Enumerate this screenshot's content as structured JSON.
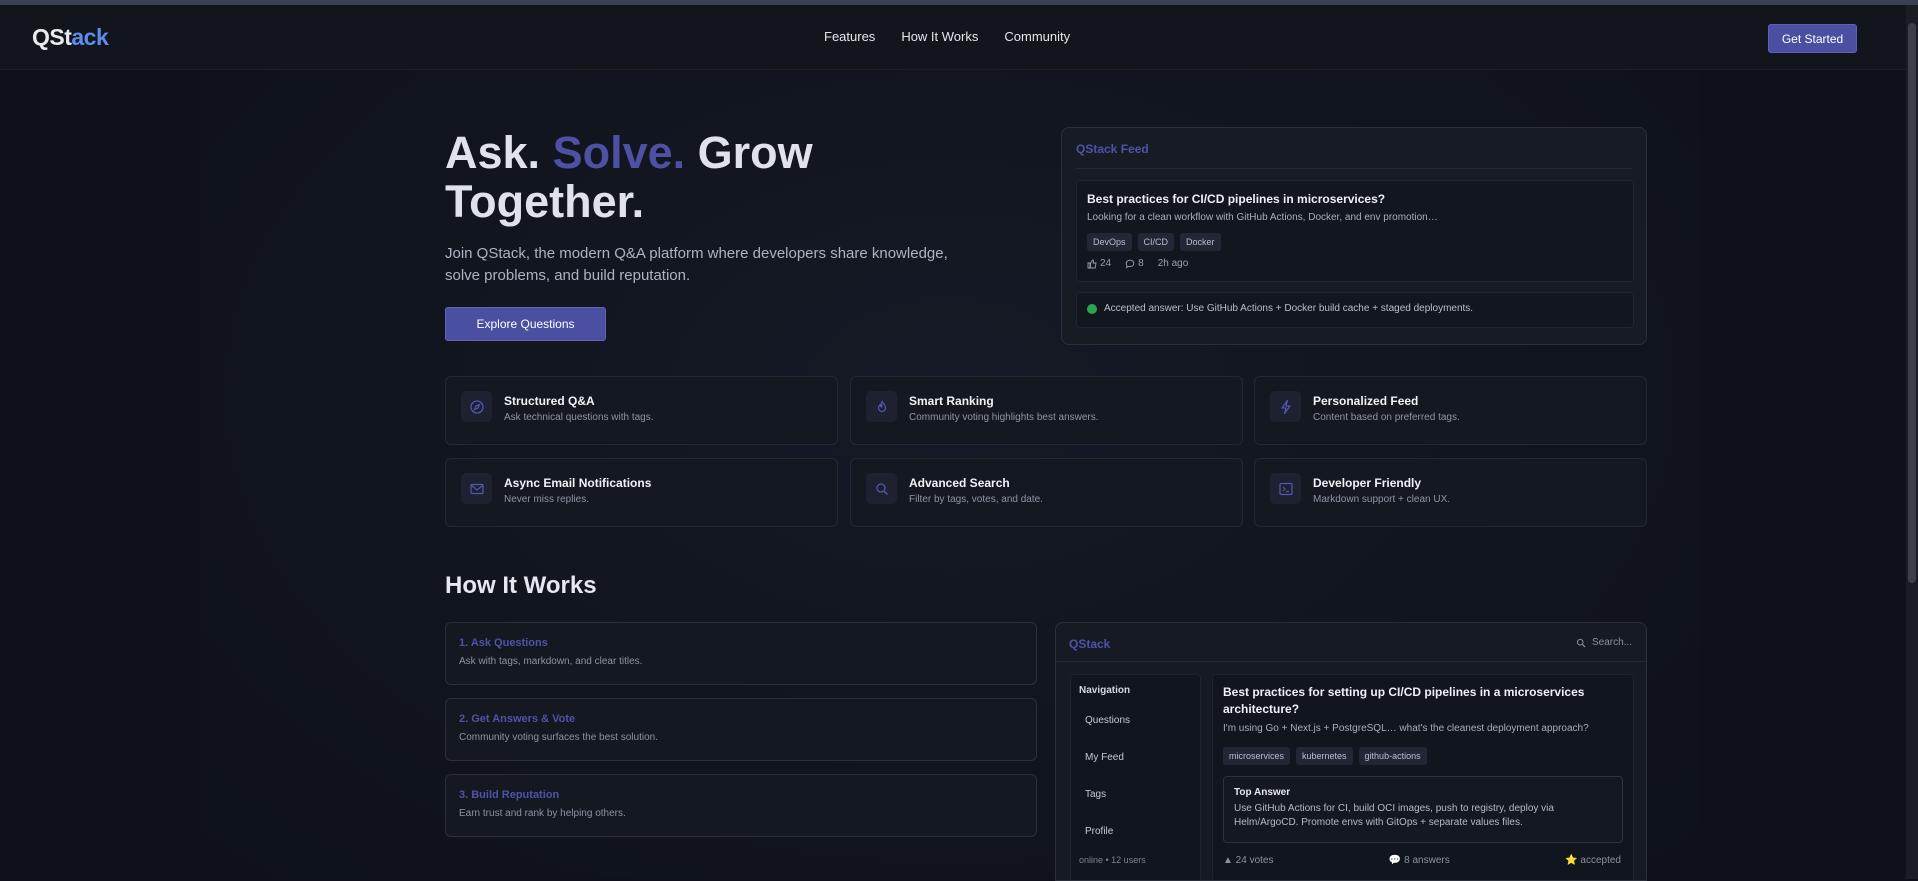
{
  "nav": {
    "logo_part1": "QSt",
    "logo_part2": "ack",
    "links": [
      "Features",
      "How It Works",
      "Community"
    ],
    "cta": "Get Started"
  },
  "hero": {
    "title_ask": "Ask.",
    "title_solve": "Solve.",
    "title_rest": "Grow Together.",
    "subtitle": "Join QStack, the modern Q&A platform where developers share knowledge, solve problems, and build reputation.",
    "button": "Explore Questions"
  },
  "feed": {
    "header": "QStack Feed",
    "question": {
      "title": "Best practices for CI/CD pipelines in microservices?",
      "excerpt": "Looking for a clean workflow with GitHub Actions, Docker, and env promotion…",
      "tags": [
        "DevOps",
        "CI/CD",
        "Docker"
      ],
      "likes": "24",
      "comments": "8",
      "time": "2h ago"
    },
    "accepted": "Accepted answer: Use GitHub Actions + Docker build cache + staged deployments."
  },
  "features": [
    {
      "title": "Structured Q&A",
      "desc": "Ask technical questions with tags.",
      "icon": "compass-icon"
    },
    {
      "title": "Smart Ranking",
      "desc": "Community voting highlights best answers.",
      "icon": "flame-icon"
    },
    {
      "title": "Personalized Feed",
      "desc": "Content based on preferred tags.",
      "icon": "bolt-icon"
    },
    {
      "title": "Async Email Notifications",
      "desc": "Never miss replies.",
      "icon": "mail-icon"
    },
    {
      "title": "Advanced Search",
      "desc": "Filter by tags, votes, and date.",
      "icon": "search-icon"
    },
    {
      "title": "Developer Friendly",
      "desc": "Markdown support + clean UX.",
      "icon": "terminal-icon"
    }
  ],
  "how": {
    "title": "How It Works",
    "steps": [
      {
        "title": "1. Ask Questions",
        "desc": "Ask with tags, markdown, and clear titles."
      },
      {
        "title": "2. Get Answers & Vote",
        "desc": "Community voting surfaces the best solution."
      },
      {
        "title": "3. Build Reputation",
        "desc": "Earn trust and rank by helping others."
      }
    ]
  },
  "app": {
    "logo": "QStack",
    "search_placeholder": "Search...",
    "nav_heading": "Navigation",
    "nav_items": [
      "Questions",
      "My Feed",
      "Tags",
      "Profile"
    ],
    "online": "online • 12 users",
    "question_title": "Best practices for setting up CI/CD pipelines in a microservices architecture?",
    "question_desc": "I'm using Go + Next.js + PostgreSQL… what's the cleanest deployment approach?",
    "tags": [
      "microservices",
      "kubernetes",
      "github-actions"
    ],
    "answer_heading": "Top Answer",
    "answer_text": "Use GitHub Actions for CI, build OCI images, push to registry, deploy via Helm/ArgoCD. Promote envs with GitOps + separate values files.",
    "votes": "▲ 24 votes",
    "answers": "💬 8 answers",
    "accepted": "⭐ accepted"
  },
  "colors": {
    "accent": "#4d50a3",
    "logo_blue": "#5b8def",
    "background": "#0e1118",
    "success": "#2ea44f"
  }
}
